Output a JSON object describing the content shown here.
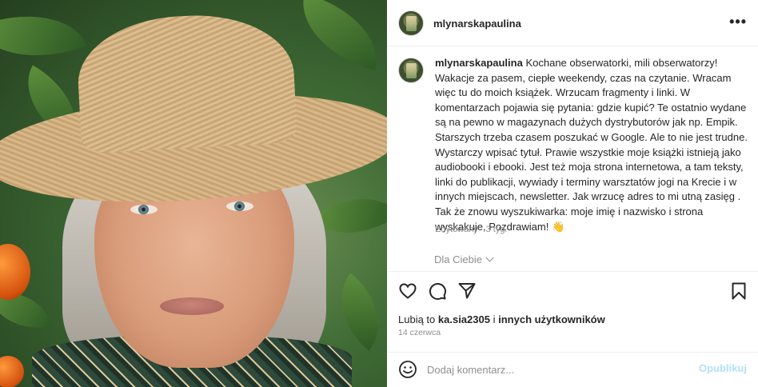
{
  "post": {
    "photo_alt": "photo",
    "author": "mlynarskapaulina",
    "more_glyph": "•••",
    "caption_text": "Kochane obserwatorki, mili obserwatorzy! Wakacje za pasem, ciepłe weekendy, czas na czytanie. Wracam więc tu do moich książek. Wrzucam fragmenty i linki. W komentarzach pojawia się pytania: gdzie kupić? Te ostatnio wydane są na pewno w magazynach dużych dystrybutorów jak np. Empik. Starszych trzeba czasem poszukać w Google. Ale to nie jest trudne. Wystarczy wpisać tytuł. Prawie wszystkie moje książki istnieją jako audiobooki i ebooki. Jest też moja strona internetowa, a tam teksty, linki do publikacji, wywiady i terminy warsztatów jogi na Krecie i w innych miejscach, newsletter. Jak wrzucę adres to mi utną zasięg . Tak że znowu wyszukiwarka: moje imię i nazwisko i strona wyskakuje, Pozdrawiam! 👋",
    "edited": "Edytowany · 3 tyg.",
    "language_toggle": "Dla Ciebie",
    "likes_prefix": "Lubią to",
    "likes_user": "ka.sia2305",
    "likes_connector": "i",
    "likes_suffix": "innych użytkowników",
    "date": "14 czerwca"
  },
  "icons": {
    "like": "heart-icon",
    "comment": "comment-icon",
    "share": "send-icon",
    "save": "bookmark-icon",
    "emoji": "emoji-icon"
  },
  "comment_box": {
    "placeholder": "Dodaj komentarz...",
    "submit_label": "Opublikuj"
  },
  "colors": {
    "text": "#262626",
    "secondary": "#8e8e8e",
    "publish_disabled": "#b2dffc",
    "divider": "#efefef"
  }
}
